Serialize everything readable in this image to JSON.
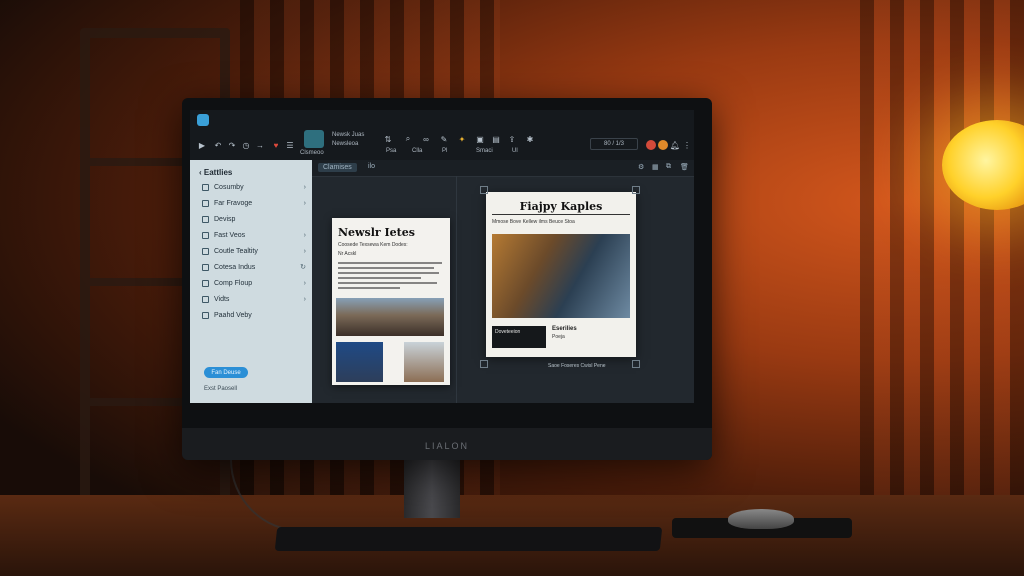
{
  "toolbar": {
    "doc_title": "Newsk Juas",
    "doc_sub": "Newsleoa",
    "zoom": "80 / 1/3",
    "label_a": "Clsmeoo",
    "label_b": "Psa",
    "label_c": "Clla",
    "label_d": "Pl",
    "label_e": "Smaci",
    "label_f": "Ul"
  },
  "sidebar": {
    "title": "Eattlies",
    "items": [
      {
        "label": "Cosumby"
      },
      {
        "label": "Far Fravoge"
      },
      {
        "label": "Devisp"
      },
      {
        "label": "Fast Veos"
      },
      {
        "label": "Coutle Tealtity"
      },
      {
        "label": "Cotesa Indus"
      },
      {
        "label": "Comp Floup"
      },
      {
        "label": "Vidts"
      },
      {
        "label": "Paahd Veby"
      }
    ],
    "button": "Fan Deuse",
    "footer": "Exst Paosell"
  },
  "main": {
    "tabs": [
      {
        "label": "Clamises"
      },
      {
        "label": "ilo"
      }
    ]
  },
  "page1": {
    "title": "Newslr Ietes",
    "subtitle": "Coosede Texsewa Kem Dodes:",
    "meta": "Nr  Acskl"
  },
  "page2": {
    "title": "Fiajpy Kaples",
    "meta": "Mmose  Bove  Kellew  ilms  Beuce  Stoa",
    "caption": "Doveteeion",
    "label": "Eserilies",
    "small": "Poeja",
    "footer": "Saoe Foseres  Cwisl  Pene"
  },
  "monitor": {
    "brand": "LIALON"
  }
}
